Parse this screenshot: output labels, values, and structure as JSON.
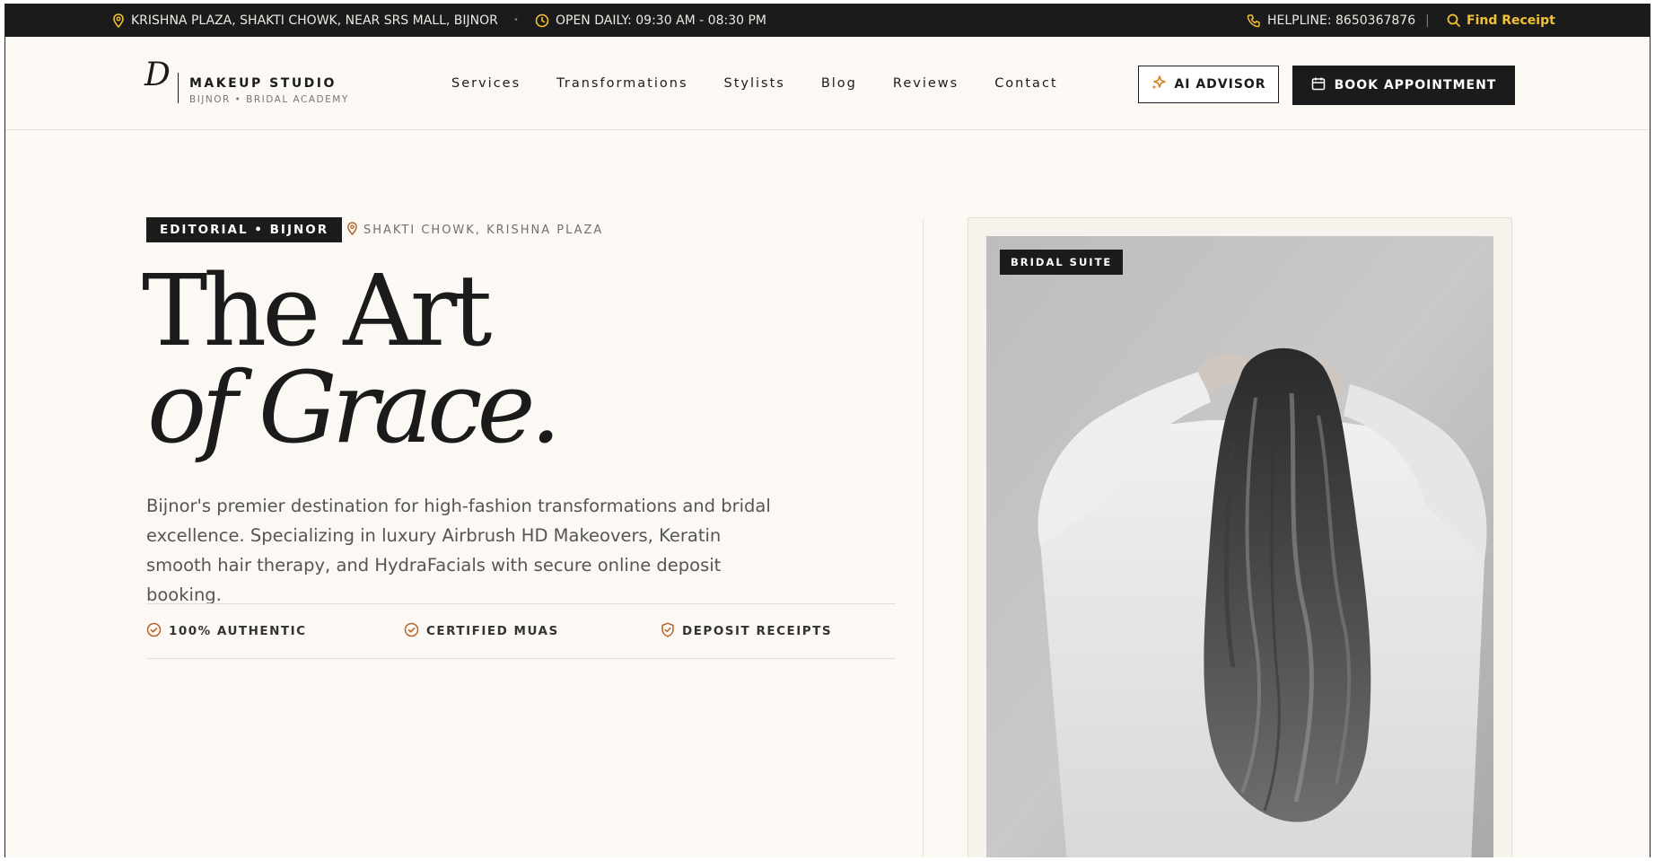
{
  "topbar": {
    "address": "KRISHNA PLAZA, SHAKTI CHOWK, NEAR SRS MALL, BIJNOR",
    "hours": "OPEN DAILY: 09:30 AM - 08:30 PM",
    "helpline": "HELPLINE: 8650367876",
    "separator": "|",
    "dot": "•",
    "find_receipt": "Find Receipt"
  },
  "brand": {
    "logo_letter": "D",
    "name": "MAKEUP STUDIO",
    "tagline": "BIJNOR • BRIDAL ACADEMY"
  },
  "nav": {
    "items": [
      "Services",
      "Transformations",
      "Stylists",
      "Blog",
      "Reviews",
      "Contact"
    ]
  },
  "actions": {
    "ai_advisor": "AI ADVISOR",
    "book": "BOOK APPOINTMENT"
  },
  "hero": {
    "badge": "EDITORIAL • BIJNOR",
    "location": "SHAKTI CHOWK, KRISHNA PLAZA",
    "title_line1": "The Art",
    "title_line2": "of Grace.",
    "description": "Bijnor's premier destination for high-fashion transformations and bridal excellence. Specializing in luxury Airbrush HD Makeovers, Keratin smooth hair therapy, and HydraFacials with secure online deposit booking.",
    "features": [
      "100% AUTHENTIC",
      "CERTIFIED MUAS",
      "DEPOSIT RECEIPTS"
    ]
  },
  "photo": {
    "badge": "BRIDAL SUITE"
  },
  "colors": {
    "accent": "#b5652a",
    "gold": "#f2c232",
    "dark": "#1b1b1b",
    "background": "#fcf9f5"
  }
}
